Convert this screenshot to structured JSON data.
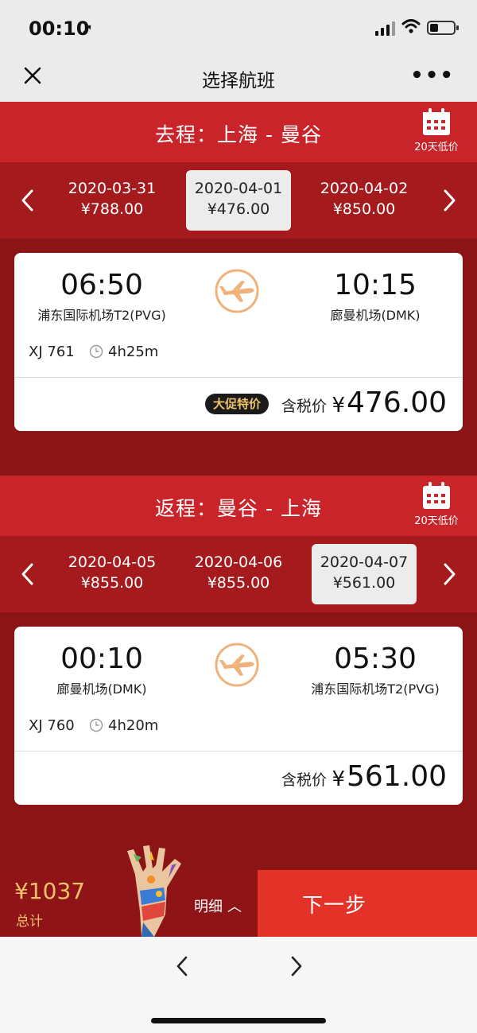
{
  "status": {
    "time": "00:10"
  },
  "nav": {
    "title": "选择航班"
  },
  "outbound": {
    "header": "去程：上海 - 曼谷",
    "calendar_label": "20天低价",
    "dates": [
      {
        "date": "2020-03-31",
        "price": "¥788.00",
        "selected": false
      },
      {
        "date": "2020-04-01",
        "price": "¥476.00",
        "selected": true
      },
      {
        "date": "2020-04-02",
        "price": "¥850.00",
        "selected": false
      }
    ],
    "flight": {
      "dep_time": "06:50",
      "dep_airport": "浦东国际机场T2(PVG)",
      "arr_time": "10:15",
      "arr_airport": "廊曼机场(DMK)",
      "flight_no": "XJ 761",
      "duration": "4h25m",
      "promo": "大促特价",
      "tax_label": "含税价",
      "price_yen": "¥",
      "price_value": "476.00"
    }
  },
  "return": {
    "header": "返程：曼谷 - 上海",
    "calendar_label": "20天低价",
    "dates": [
      {
        "date": "2020-04-05",
        "price": "¥855.00",
        "selected": false
      },
      {
        "date": "2020-04-06",
        "price": "¥855.00",
        "selected": false
      },
      {
        "date": "2020-04-07",
        "price": "¥561.00",
        "selected": true
      }
    ],
    "flight": {
      "dep_time": "00:10",
      "dep_airport": "廊曼机场(DMK)",
      "arr_time": "05:30",
      "arr_airport": "浦东国际机场T2(PVG)",
      "flight_no": "XJ 760",
      "duration": "4h20m",
      "tax_label": "含税价",
      "price_yen": "¥",
      "price_value": "561.00"
    }
  },
  "bottom": {
    "total": "¥1037",
    "total_label": "总计",
    "detail": "明细",
    "next": "下一步"
  },
  "colors": {
    "brand_red": "#c9242a",
    "dark_red": "#8a1416",
    "next_red": "#e53228",
    "gold": "#f0c36a",
    "logo_orange": "#f0b27a"
  }
}
